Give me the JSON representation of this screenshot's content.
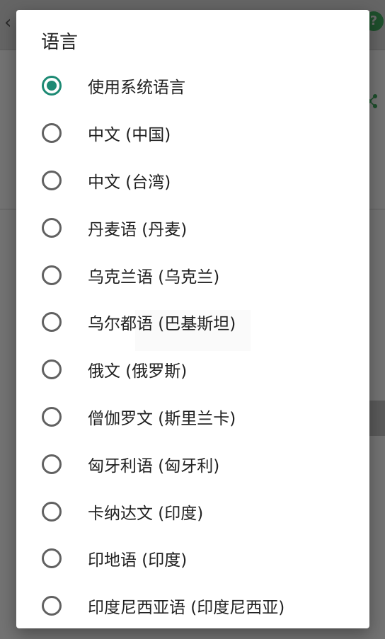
{
  "dialog": {
    "title": "语言",
    "selected_index": 0,
    "options": [
      {
        "label": "使用系统语言",
        "checked": true
      },
      {
        "label": "中文 (中国)",
        "checked": false
      },
      {
        "label": "中文 (台湾)",
        "checked": false
      },
      {
        "label": "丹麦语 (丹麦)",
        "checked": false
      },
      {
        "label": "乌克兰语 (乌克兰)",
        "checked": false
      },
      {
        "label": "乌尔都语 (巴基斯坦)",
        "checked": false
      },
      {
        "label": "俄文 (俄罗斯)",
        "checked": false
      },
      {
        "label": "僧伽罗文 (斯里兰卡)",
        "checked": false
      },
      {
        "label": "匈牙利语 (匈牙利)",
        "checked": false
      },
      {
        "label": "卡纳达文 (印度)",
        "checked": false
      },
      {
        "label": "印地语 (印度)",
        "checked": false
      },
      {
        "label": "印度尼西亚语 (印度尼西亚)",
        "checked": false
      }
    ]
  },
  "background": {
    "back_icon": "arrow-back-icon",
    "help_icon": "help-icon",
    "help_glyph": "?",
    "share_icon": "share-icon"
  },
  "colors": {
    "accent": "#1d8a74",
    "radio_unchecked": "#616161",
    "scrim": "#737373"
  }
}
